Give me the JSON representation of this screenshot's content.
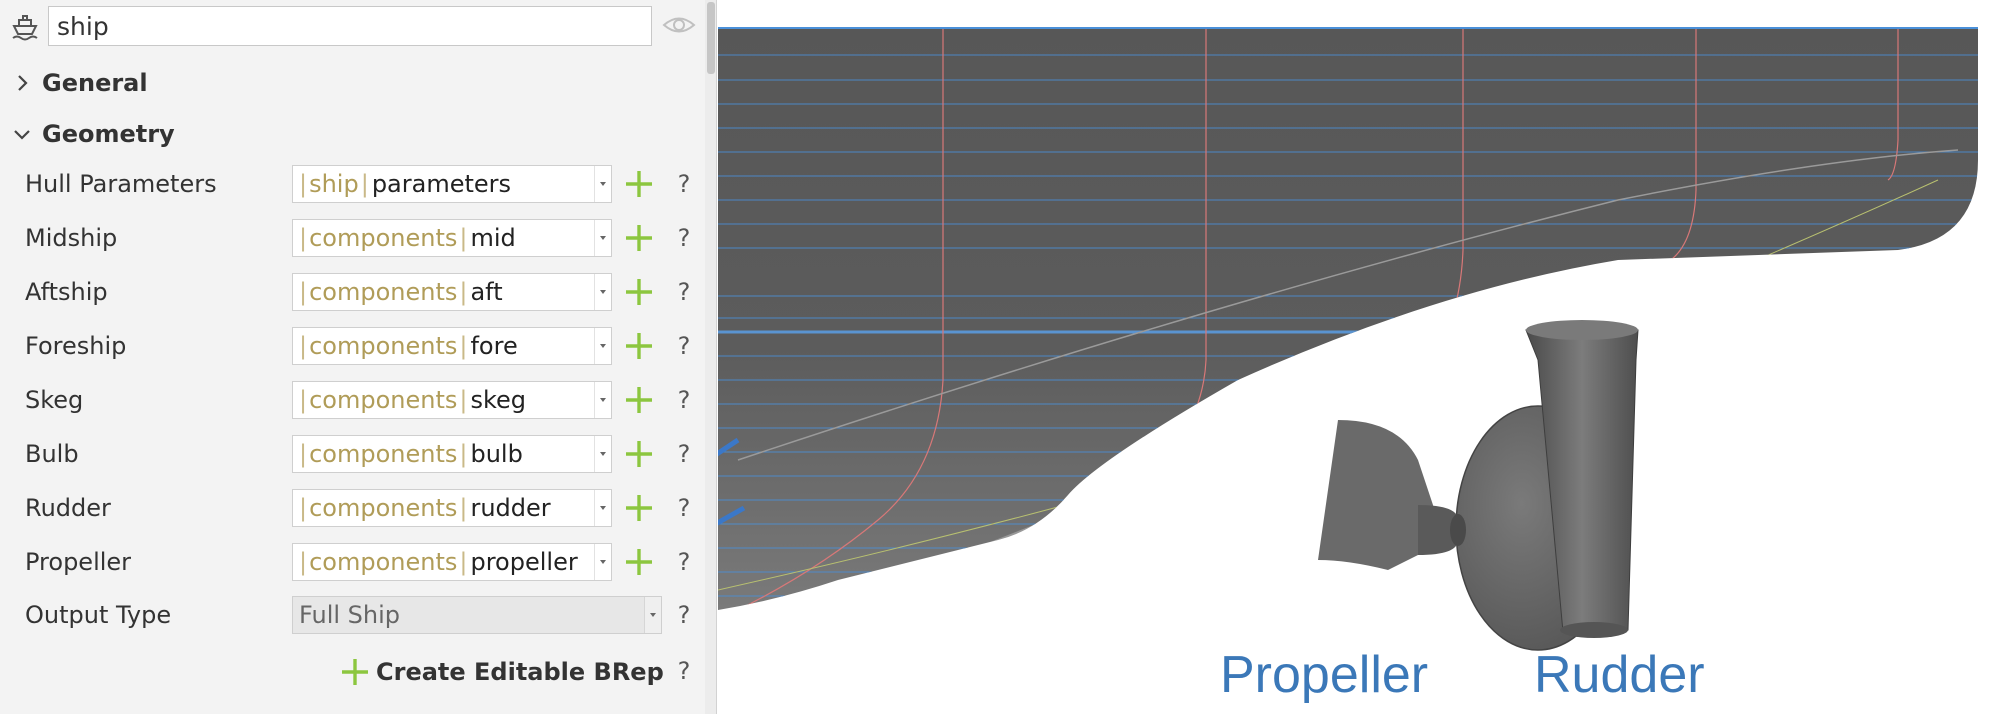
{
  "object": {
    "name": "ship",
    "icon": "ship-icon",
    "visibility_icon": "eye-icon"
  },
  "sections": {
    "general": {
      "label": "General",
      "expanded": false
    },
    "geometry": {
      "label": "Geometry",
      "expanded": true
    }
  },
  "properties": [
    {
      "label": "Hull Parameters",
      "prefix": "ship",
      "value": "parameters"
    },
    {
      "label": "Midship",
      "prefix": "components",
      "value": "mid"
    },
    {
      "label": "Aftship",
      "prefix": "components",
      "value": "aft"
    },
    {
      "label": "Foreship",
      "prefix": "components",
      "value": "fore"
    },
    {
      "label": "Skeg",
      "prefix": "components",
      "value": "skeg"
    },
    {
      "label": "Bulb",
      "prefix": "components",
      "value": "bulb"
    },
    {
      "label": "Rudder",
      "prefix": "components",
      "value": "rudder"
    },
    {
      "label": "Propeller",
      "prefix": "components",
      "value": "propeller"
    }
  ],
  "output_type": {
    "label": "Output Type",
    "value": "Full Ship"
  },
  "help_glyph": "?",
  "actions": {
    "create_brep": "Create Editable BRep"
  },
  "viewport": {
    "labels": {
      "propeller": "Propeller",
      "rudder": "Rudder"
    },
    "colors": {
      "hull": "#5a5a5a",
      "label": "#3b78b8",
      "waterline": "#4a90d9",
      "section_line": "#d87878",
      "arrow": "#3b78c8"
    }
  },
  "colors": {
    "accent_plus": "#8cc63f",
    "path_prefix": "#b09c58"
  }
}
